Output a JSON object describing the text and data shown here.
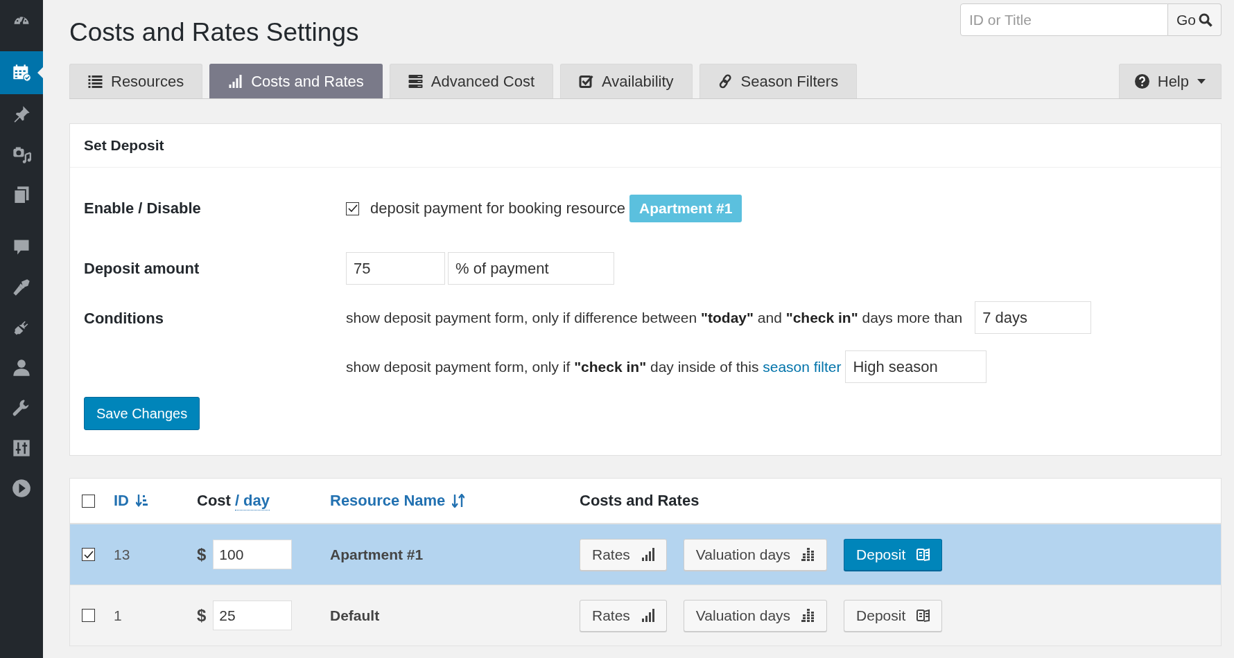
{
  "sidebar": {
    "items": [
      {
        "kind": "dashboard",
        "selected": false
      },
      {
        "kind": "calendar",
        "selected": true
      },
      {
        "kind": "pin",
        "selected": false
      },
      {
        "kind": "media",
        "selected": false
      },
      {
        "kind": "pages",
        "selected": false
      },
      {
        "kind": "comments",
        "selected": false
      },
      {
        "kind": "appearance",
        "selected": false
      },
      {
        "kind": "plugins",
        "selected": false
      },
      {
        "kind": "users",
        "selected": false
      },
      {
        "kind": "tools",
        "selected": false
      },
      {
        "kind": "settings",
        "selected": false
      },
      {
        "kind": "play",
        "selected": false
      }
    ]
  },
  "page_title": "Costs and Rates Settings",
  "search": {
    "placeholder": "ID or Title",
    "button_label": "Go"
  },
  "tabs": [
    {
      "label": "Resources",
      "kind": "list",
      "selected": false
    },
    {
      "label": "Costs and Rates",
      "kind": "bars",
      "selected": true
    },
    {
      "label": "Advanced Cost",
      "kind": "server",
      "selected": false
    },
    {
      "label": "Availability",
      "kind": "check",
      "selected": false
    },
    {
      "label": "Season Filters",
      "kind": "link",
      "selected": false
    }
  ],
  "help_button": {
    "label": "Help"
  },
  "deposit_panel": {
    "title": "Set Deposit",
    "enable": {
      "label": "Enable / Disable",
      "checked": true,
      "text": "deposit payment for booking resource",
      "resource_badge": "Apartment #1"
    },
    "amount": {
      "label": "Deposit amount",
      "value": "75",
      "unit": "% of payment"
    },
    "conditions": {
      "label": "Conditions",
      "rules": [
        {
          "text": "show deposit payment form, only if difference between **\"today\"** and **\"check in\"** days more than",
          "value": "7 days"
        },
        {
          "text": "show deposit payment form, only if **\"check in\"** day inside of this",
          "link": "season filter",
          "value": "High season"
        }
      ]
    },
    "save_button": "Save Changes"
  },
  "table": {
    "select_all_checked": false,
    "columns": [
      {
        "label": "ID",
        "kind": "sort_numeric"
      },
      {
        "label": "Cost",
        "link": "/ day",
        "kind": "plain"
      },
      {
        "label": "Resource Name",
        "kind": "sort"
      },
      {
        "label": "Costs and Rates",
        "kind": "plain"
      }
    ],
    "rows": [
      {
        "selected": true,
        "checked": true,
        "id": "13",
        "currency": "$",
        "cost": "100",
        "name": "Apartment #1",
        "actions": [
          {
            "label": "Rates",
            "kind": "rates",
            "primary": false
          },
          {
            "label": "Valuation days",
            "kind": "valuation",
            "primary": false
          },
          {
            "label": "Deposit",
            "kind": "deposit",
            "primary": true
          }
        ]
      },
      {
        "selected": false,
        "checked": false,
        "id": "1",
        "currency": "$",
        "cost": "25",
        "name": "Default",
        "actions": [
          {
            "label": "Rates",
            "kind": "rates",
            "primary": false
          },
          {
            "label": "Valuation days",
            "kind": "valuation",
            "primary": false
          },
          {
            "label": "Deposit",
            "kind": "deposit",
            "primary": false
          }
        ]
      }
    ]
  }
}
